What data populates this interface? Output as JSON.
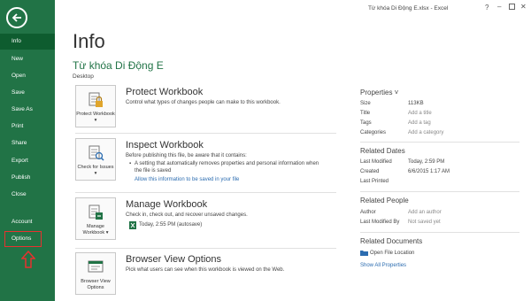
{
  "window": {
    "title": "Từ khóa Di Động E.xlsx - Excel",
    "help": "?",
    "minimize": "–",
    "close": "✕"
  },
  "sidebar": {
    "items": [
      {
        "label": "Info"
      },
      {
        "label": "New"
      },
      {
        "label": "Open"
      },
      {
        "label": "Save"
      },
      {
        "label": "Save As"
      },
      {
        "label": "Print"
      },
      {
        "label": "Share"
      },
      {
        "label": "Export"
      },
      {
        "label": "Publish"
      },
      {
        "label": "Close"
      },
      {
        "label": "Account"
      },
      {
        "label": "Options"
      }
    ],
    "active_index": 0,
    "bg_color": "#217346"
  },
  "main": {
    "title": "Info",
    "file_name": "Từ khóa Di Động E",
    "location": "Desktop",
    "cards": [
      {
        "icon_label": "Protect Workbook ▾",
        "title": "Protect Workbook",
        "desc": [
          "Control what types of changes people can make to this workbook."
        ]
      },
      {
        "icon_label": "Check for Issues ▾",
        "title": "Inspect Workbook",
        "desc": [
          "Before publishing this file, be aware that it contains:",
          "A setting that automatically removes properties and personal information when",
          "the file is saved"
        ],
        "link": "Allow this information to be saved in your file"
      },
      {
        "icon_label": "Manage Workbook ▾",
        "title": "Manage Workbook",
        "desc": [
          "Check in, check out, and recover unsaved changes."
        ],
        "version": "Today, 2:55 PM (autosave)"
      },
      {
        "icon_label": "Browser View Options",
        "title": "Browser View Options",
        "desc": [
          "Pick what users can see when this workbook is viewed on the Web."
        ]
      }
    ]
  },
  "properties": {
    "header": "Properties ˅",
    "rows": [
      {
        "label": "Size",
        "value": "113KB"
      },
      {
        "label": "Title",
        "value": "Add a title"
      },
      {
        "label": "Tags",
        "value": "Add a tag"
      },
      {
        "label": "Categories",
        "value": "Add a category"
      }
    ],
    "dates_header": "Related Dates",
    "dates": [
      {
        "label": "Last Modified",
        "value": "Today, 2:59 PM"
      },
      {
        "label": "Created",
        "value": "6/6/2015 1:17 AM"
      },
      {
        "label": "Last Printed",
        "value": ""
      }
    ],
    "people_header": "Related People",
    "people": [
      {
        "label": "Author",
        "value": "Add an author"
      },
      {
        "label": "Last Modified By",
        "value": "Not saved yet"
      }
    ],
    "docs_header": "Related Documents",
    "open_location": "Open File Location",
    "show_all": "Show All Properties"
  },
  "colors": {
    "accent": "#217346",
    "annotation": "#e8312f",
    "link": "#2b6cb0"
  }
}
